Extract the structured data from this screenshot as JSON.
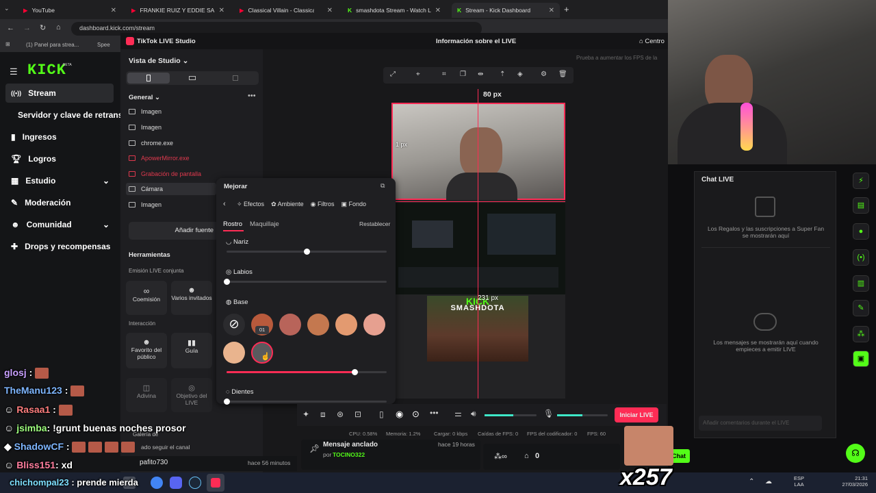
{
  "browser": {
    "tabs": [
      {
        "label": "YouTube",
        "color": "#ff0033"
      },
      {
        "label": "FRANKIE RUIZ Y EDDIE SANTIAGO",
        "color": "#ff0033"
      },
      {
        "label": "Classical Villain - Classical M...",
        "color": "#ff0033"
      },
      {
        "label": "smashdota Stream - Watch Live",
        "color": "#53fc18"
      },
      {
        "label": "Stream - Kick Dashboard",
        "color": "#53fc18"
      }
    ],
    "new_tab": "+",
    "url": "dashboard.kick.com/stream",
    "bookmarks": [
      "(1) Panel para strea...",
      "Spee"
    ]
  },
  "kick": {
    "logo": "KICK",
    "beta": "BETA",
    "nav": [
      {
        "label": "Stream",
        "icon": "broadcast-icon",
        "active": true
      },
      {
        "label": "Servidor y clave de retransmisión",
        "icon": ""
      },
      {
        "label": "Ingresos",
        "icon": "chart-icon"
      },
      {
        "label": "Logros",
        "icon": "trophy-icon"
      },
      {
        "label": "Estudio",
        "icon": "grid-icon",
        "chevron": true
      },
      {
        "label": "Moderación",
        "icon": "wrench-icon"
      },
      {
        "label": "Comunidad",
        "icon": "people-icon",
        "chevron": true
      },
      {
        "label": "Drops y recompensas",
        "icon": "gift-icon"
      }
    ]
  },
  "studio": {
    "app_title": "TikTok LIVE Studio",
    "header_center": "Información sobre el LIVE",
    "header_right": "Centro",
    "hint": "Prueba a aumentar los FPS de la",
    "view_title": "Vista de Studio",
    "section_general": "General",
    "sources": [
      {
        "label": "Imagen",
        "warn": false
      },
      {
        "label": "Imagen",
        "warn": false
      },
      {
        "label": "chrome.exe",
        "warn": false
      },
      {
        "label": "ApowerMirror.exe",
        "warn": true
      },
      {
        "label": "Grabación de pantalla",
        "warn": true
      },
      {
        "label": "Cámara",
        "warn": false,
        "selected": true
      },
      {
        "label": "Imagen",
        "warn": false
      }
    ],
    "add_source": "Añadir fuente",
    "tools_title": "Herramientas",
    "joint_title": "Emisión LIVE conjunta",
    "joint_tools": [
      "Coemisión",
      "Varios invitados"
    ],
    "interaction_title": "Interacción",
    "interaction_tools": [
      "Favorito del público",
      "Guía",
      "Adivina",
      "Objetivo del LIVE"
    ],
    "gallery": "Galería de",
    "follow_text": "ado seguir el canal"
  },
  "enhance": {
    "title": "Mejorar",
    "tabs": [
      "Efectos",
      "Ambiente",
      "Filtros",
      "Fondo"
    ],
    "subtabs": [
      "Rostro",
      "Maquillaje"
    ],
    "reset": "Restablecer",
    "nose": "Nariz",
    "nose_value": 0.5,
    "lips": "Labios",
    "lips_value": 0.0,
    "base": "Base",
    "tooltip": "01",
    "base_value": 0.8,
    "teeth": "Dientes",
    "teeth_value": 0.0,
    "swatches": [
      "none",
      "#b85a3c",
      "#b8645a",
      "#c4784f",
      "#e39a70",
      "#e6a090",
      "#e9b48e",
      "#5a5a5e"
    ]
  },
  "canvas": {
    "top_px": "80 px",
    "left_px": "1 px",
    "mid_px": "231 px",
    "game_title": "SMASHDOTA",
    "game_logo": "KICK"
  },
  "controls": {
    "start_live": "Iniciar LIVE",
    "stats": [
      "CPU: 0.58%",
      "Memoria: 1.2%",
      "Cargar: 0 kbps",
      "Caídas de FPS: 0",
      "FPS del codificador: 0",
      "FPS: 60"
    ],
    "vol_level": 0.55,
    "mic_level": 0.5
  },
  "chat": {
    "title": "Chat LIVE",
    "gifts_msg": "Los Regalos y las suscripciones a Super Fan se mostrarán aquí",
    "msgs_msg": "Los mensajes se mostrarán aquí cuando empieces a emitir LIVE",
    "input_placeholder": "Añadir comentarios durante el LIVE"
  },
  "pinned": {
    "title": "Mensaje anclado",
    "by": "por",
    "author": "TOCINO322",
    "time": "hace 19 horas",
    "user": "pafito730",
    "user_time": "hace 56 minutos",
    "count": "0",
    "count2": "0",
    "chat_btn": "Chat"
  },
  "overlay_chat": [
    {
      "user": "glosj",
      "text": ":",
      "color": "#c8a0ff"
    },
    {
      "user": "TheManu123",
      "text": ":",
      "color": "#7eb6ff"
    },
    {
      "user": "Rasaa1",
      "text": ":",
      "color": "#ff7e7e"
    },
    {
      "user": "jsimba",
      "text": ": !grunt buenas noches prosor",
      "color": "#9eff7e"
    },
    {
      "user": "ShadowCF",
      "text": ":",
      "color": "#7eb6ff"
    },
    {
      "user": "Bliss151",
      "text": ": xd",
      "color": "#ff7e9e"
    },
    {
      "user": "chichompal23",
      "text": ": prende mierda",
      "color": "#7ee0ff"
    }
  ],
  "combo": "x257",
  "taskbar": {
    "lang": "ESP",
    "lang2": "LAA",
    "time": "21:31",
    "date": "27/03/2026"
  }
}
